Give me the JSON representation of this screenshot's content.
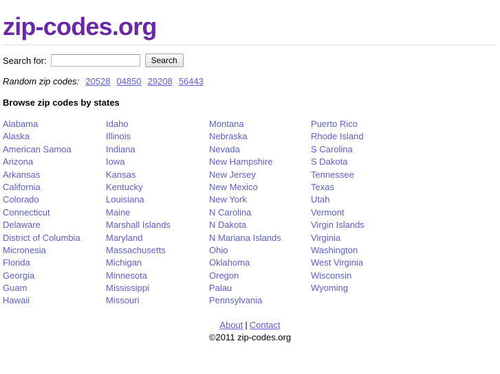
{
  "header": {
    "title": "zip-codes.org",
    "title_color": "#6a27a8"
  },
  "search": {
    "label": "Search for:",
    "value": "",
    "placeholder": "",
    "button_label": "Search"
  },
  "random": {
    "label": "Random zip codes:",
    "codes": [
      "20528",
      "04850",
      "29208",
      "56443"
    ]
  },
  "browse": {
    "heading": "Browse zip codes by states",
    "link_color": "#5c5cd6",
    "columns": [
      {
        "items": [
          "Alabama",
          "Alaska",
          "American Samoa",
          "Arizona",
          "Arkansas",
          "California",
          "Colorado",
          "Connecticut",
          "Delaware",
          "District of Columbia",
          "Micronesia",
          "Florida",
          "Georgia",
          "Guam",
          "Hawaii"
        ]
      },
      {
        "items": [
          "Idaho",
          "Illinois",
          "Indiana",
          "Iowa",
          "Kansas",
          "Kentucky",
          "Louisiana",
          "Maine",
          "Marshall Islands",
          "Maryland",
          "Massachusetts",
          "Michigan",
          "Minnesota",
          "Mississippi",
          "Missouri"
        ]
      },
      {
        "items": [
          "Montana",
          "Nebraska",
          "Nevada",
          "New Hampshire",
          "New Jersey",
          "New Mexico",
          "New York",
          "N Carolina",
          "N Dakota",
          "N Mariana Islands",
          "Ohio",
          "Oklahoma",
          "Oregon",
          "Palau",
          "Pennsylvania"
        ]
      },
      {
        "items": [
          "Puerto Rico",
          "Rhode Island",
          "S Carolina",
          "S Dakota",
          "Tennessee",
          "Texas",
          "Utah",
          "Vermont",
          "Virgin Islands",
          "Virginia",
          "Washington",
          "West Virginia",
          "Wisconsin",
          "Wyoming"
        ]
      }
    ]
  },
  "footer": {
    "about_label": "About",
    "separator": "|",
    "contact_label": "Contact",
    "copyright": "©2011 zip-codes.org"
  }
}
